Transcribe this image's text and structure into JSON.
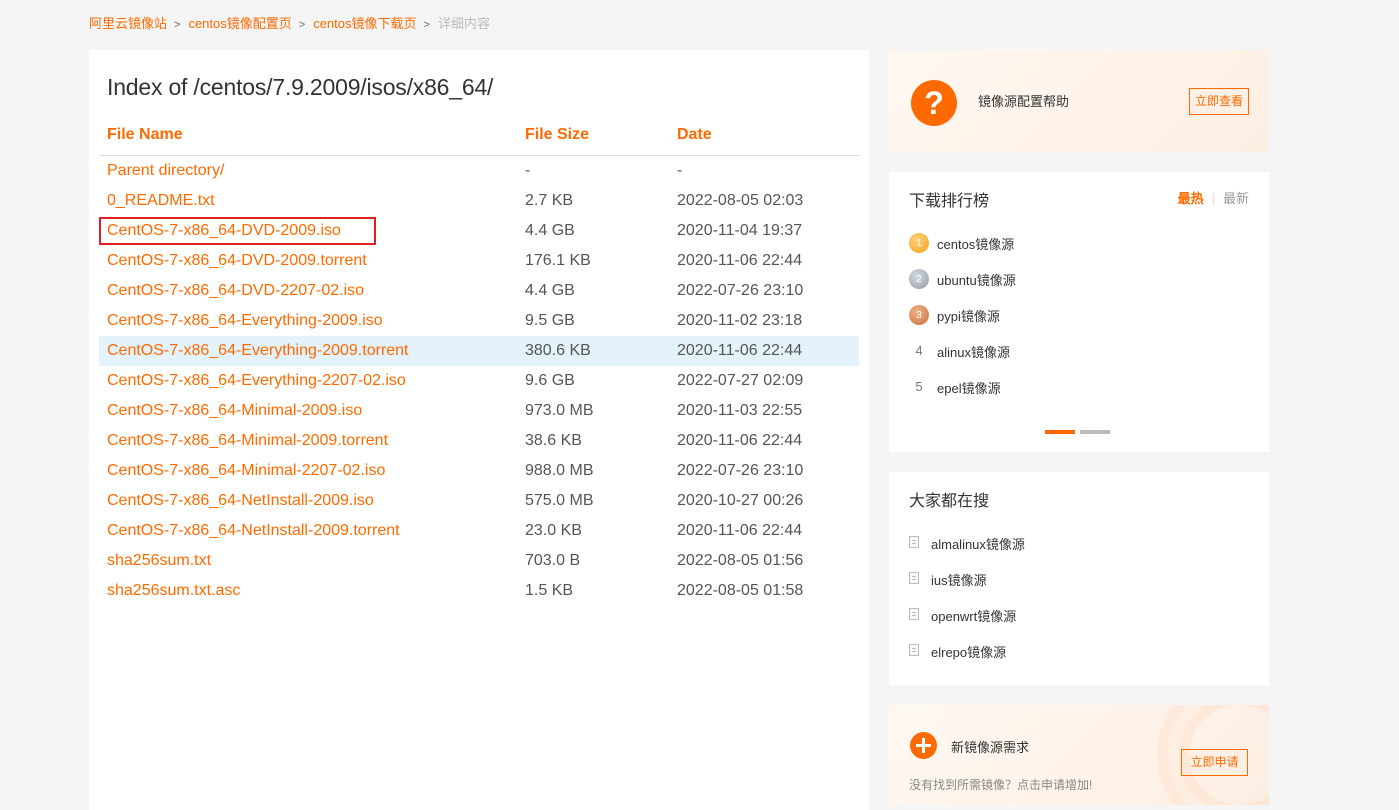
{
  "breadcrumb": {
    "items": [
      "阿里云镜像站",
      "centos镜像配置页",
      "centos镜像下载页"
    ],
    "separator": ">",
    "current": "详细内容"
  },
  "index": {
    "title": "Index of /centos/7.9.2009/isos/x86_64/",
    "headers": {
      "name": "File Name",
      "size": "File Size",
      "date": "Date"
    },
    "rows": [
      {
        "name": "Parent directory/",
        "size": "-",
        "date": "-"
      },
      {
        "name": "0_README.txt",
        "size": "2.7 KB",
        "date": "2022-08-05 02:03"
      },
      {
        "name": "CentOS-7-x86_64-DVD-2009.iso",
        "size": "4.4 GB",
        "date": "2020-11-04 19:37"
      },
      {
        "name": "CentOS-7-x86_64-DVD-2009.torrent",
        "size": "176.1 KB",
        "date": "2020-11-06 22:44"
      },
      {
        "name": "CentOS-7-x86_64-DVD-2207-02.iso",
        "size": "4.4 GB",
        "date": "2022-07-26 23:10"
      },
      {
        "name": "CentOS-7-x86_64-Everything-2009.iso",
        "size": "9.5 GB",
        "date": "2020-11-02 23:18"
      },
      {
        "name": "CentOS-7-x86_64-Everything-2009.torrent",
        "size": "380.6 KB",
        "date": "2020-11-06 22:44"
      },
      {
        "name": "CentOS-7-x86_64-Everything-2207-02.iso",
        "size": "9.6 GB",
        "date": "2022-07-27 02:09"
      },
      {
        "name": "CentOS-7-x86_64-Minimal-2009.iso",
        "size": "973.0 MB",
        "date": "2020-11-03 22:55"
      },
      {
        "name": "CentOS-7-x86_64-Minimal-2009.torrent",
        "size": "38.6 KB",
        "date": "2020-11-06 22:44"
      },
      {
        "name": "CentOS-7-x86_64-Minimal-2207-02.iso",
        "size": "988.0 MB",
        "date": "2022-07-26 23:10"
      },
      {
        "name": "CentOS-7-x86_64-NetInstall-2009.iso",
        "size": "575.0 MB",
        "date": "2020-10-27 00:26"
      },
      {
        "name": "CentOS-7-x86_64-NetInstall-2009.torrent",
        "size": "23.0 KB",
        "date": "2020-11-06 22:44"
      },
      {
        "name": "sha256sum.txt",
        "size": "703.0 B",
        "date": "2022-08-05 01:56"
      },
      {
        "name": "sha256sum.txt.asc",
        "size": "1.5 KB",
        "date": "2022-08-05 01:58"
      }
    ]
  },
  "help": {
    "icon": "question-icon",
    "text": "镜像源配置帮助",
    "button": "立即查看"
  },
  "ranking": {
    "title": "下载排行榜",
    "tab_hot": "最热",
    "tab_sep": "|",
    "tab_new": "最新",
    "items": [
      {
        "rank": "1",
        "label": "centos镜像源"
      },
      {
        "rank": "2",
        "label": "ubuntu镜像源"
      },
      {
        "rank": "3",
        "label": "pypi镜像源"
      },
      {
        "rank": "4",
        "label": "alinux镜像源"
      },
      {
        "rank": "5",
        "label": "epel镜像源"
      }
    ]
  },
  "popular": {
    "title": "大家都在搜",
    "items": [
      "almalinux镜像源",
      "ius镜像源",
      "openwrt镜像源",
      "elrepo镜像源"
    ]
  },
  "request": {
    "icon": "plus-icon",
    "title": "新镜像源需求",
    "subtitle": "没有找到所需镜像？点击申请增加!",
    "button": "立即申请"
  },
  "colors": {
    "accent": "#ff6a00",
    "highlight_row": "#e3f2fb",
    "annotation_box": "#e02020"
  }
}
